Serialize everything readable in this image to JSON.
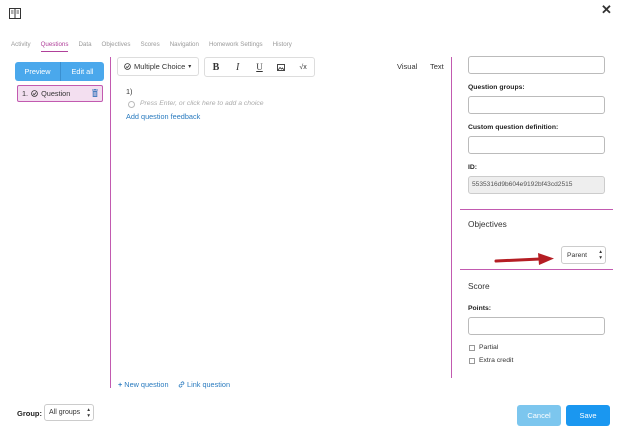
{
  "tabs": [
    {
      "label": "Activity",
      "active": false
    },
    {
      "label": "Questions",
      "active": true
    },
    {
      "label": "Data",
      "active": false
    },
    {
      "label": "Objectives",
      "active": false
    },
    {
      "label": "Scores",
      "active": false
    },
    {
      "label": "Navigation",
      "active": false
    },
    {
      "label": "Homework Settings",
      "active": false
    },
    {
      "label": "History",
      "active": false
    }
  ],
  "sidebar": {
    "preview_label": "Preview",
    "edit_all_label": "Edit all",
    "question_item": {
      "number": "1.",
      "label": "Question"
    }
  },
  "editor": {
    "type_select": "Multiple Choice",
    "mode_visual": "Visual",
    "mode_text": "Text",
    "question_number": "1)",
    "choice_placeholder": "Press Enter, or click here to add a choice",
    "feedback_link": "Add question feedback",
    "new_question": "New question",
    "link_question": "Link question"
  },
  "properties": {
    "question_groups_label": "Question groups:",
    "custom_def_label": "Custom question definition:",
    "id_label": "ID:",
    "id_value": "5535316d9b604e9192bf43cd2515",
    "objectives_title": "Objectives",
    "parent_select": "Parent",
    "score_title": "Score",
    "points_label": "Points:",
    "partial_label": "Partial",
    "extra_credit_label": "Extra credit"
  },
  "footer": {
    "group_label": "Group:",
    "group_select": "All groups",
    "cancel_label": "Cancel",
    "save_label": "Save"
  },
  "colors": {
    "accent": "#c25ab0",
    "primary": "#1a97f0",
    "primary_light": "#7cc6ee",
    "link": "#2a7bbf",
    "arrow": "#b51e24"
  }
}
